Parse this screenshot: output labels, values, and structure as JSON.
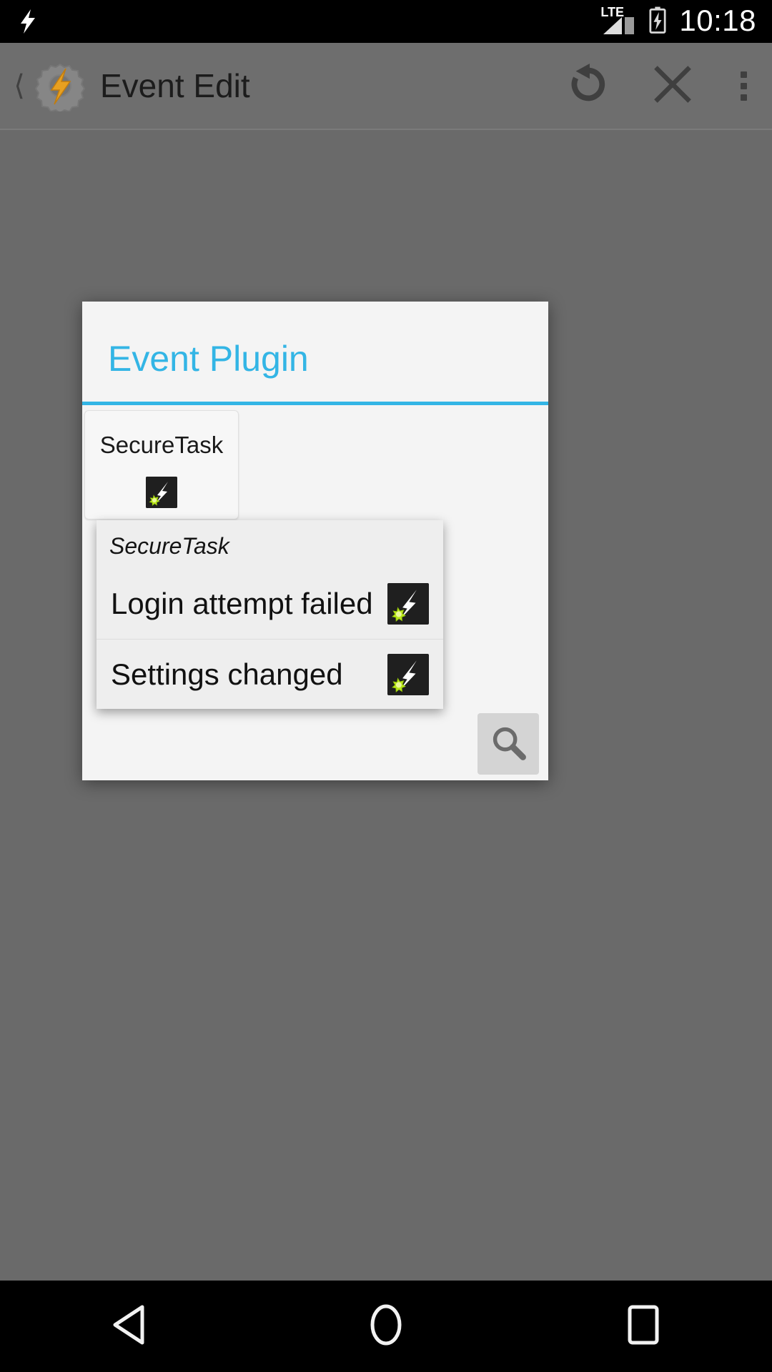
{
  "statusbar": {
    "notification_icon": "lightning-bolt-icon",
    "network_label": "LTE",
    "signal_icon": "signal-bars-icon",
    "battery_icon": "battery-charging-icon",
    "clock": "10:18"
  },
  "appbar": {
    "back_icon": "chevron-left-icon",
    "app_logo": "tasker-gear-bolt-icon",
    "title": "Event Edit",
    "actions": [
      {
        "name": "undo-button",
        "icon": "undo-rotate-icon"
      },
      {
        "name": "cancel-button",
        "icon": "close-x-icon"
      },
      {
        "name": "overflow-menu-button",
        "icon": "three-dots-vertical-icon"
      }
    ]
  },
  "dialog": {
    "title": "Event Plugin",
    "accent_color": "#33b5e5",
    "background_color": "#f4f4f4",
    "spinner": {
      "selected_label": "SecureTask",
      "icon": "securetask-plugin-icon"
    },
    "dropdown": {
      "header": "SecureTask",
      "items": [
        {
          "label": "Login attempt failed",
          "icon": "securetask-plugin-icon"
        },
        {
          "label": "Settings changed",
          "icon": "securetask-plugin-icon"
        }
      ]
    },
    "search_button": {
      "icon": "search-magnifier-icon"
    }
  },
  "navbar": {
    "back": "back-triangle-icon",
    "home": "home-circle-icon",
    "recents": "recents-square-icon"
  }
}
